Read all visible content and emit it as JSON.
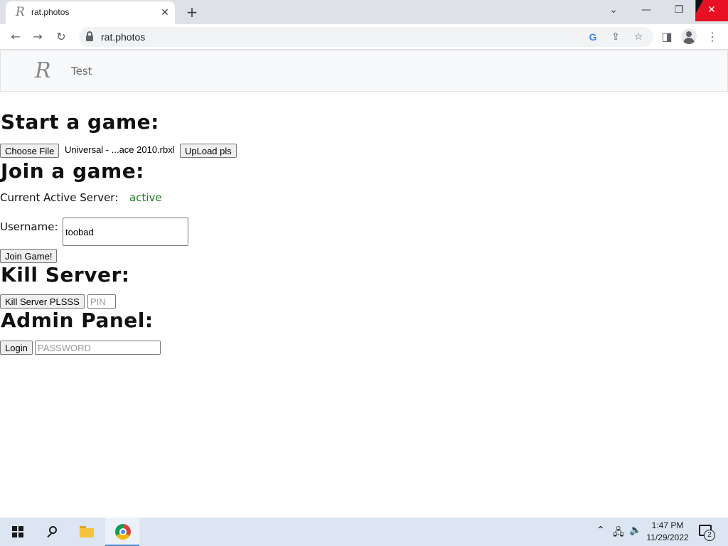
{
  "browser": {
    "tab": {
      "title": "rat.photos",
      "favicon": "R",
      "close": "✕"
    },
    "new_tab": "+",
    "window_controls": {
      "list_tabs": "⌄",
      "minimize": "—",
      "restore": "❐",
      "close": "✕"
    },
    "url": "rat.photos",
    "icons": [
      "back-icon",
      "forward-icon",
      "reload-icon",
      "lock-icon",
      "google-icon",
      "share-icon",
      "bookmark-star-icon",
      "side-panel-icon",
      "profile-icon",
      "menu-icon"
    ]
  },
  "site": {
    "nav": {
      "logo": "R",
      "link": "Test"
    }
  },
  "start_game": {
    "heading": "Start a game:",
    "choose_file_label": "Choose File",
    "file_name": "Universal - ...ace 2010.rbxl",
    "upload_label": "UpLoad pls"
  },
  "join_game": {
    "heading": "Join a game:",
    "server_label": "Current Active Server:",
    "server_status": "active",
    "username_label": "Username:",
    "username_value": "toobad",
    "join_label": "Join Game!"
  },
  "kill_server": {
    "heading": "Kill Server:",
    "button_label": "Kill Server PLSSS",
    "pin_placeholder": "PIN"
  },
  "admin_panel": {
    "heading": "Admin Panel:",
    "login_label": "Login",
    "password_placeholder": "PASSWORD"
  },
  "taskbar": {
    "time": "1:47 PM",
    "date": "11/29/2022",
    "notification_count": "2",
    "colors": {
      "accent": "#4b8fd8",
      "taskbar": "#dbe6f2",
      "status_active": "#1a7a1a"
    }
  }
}
